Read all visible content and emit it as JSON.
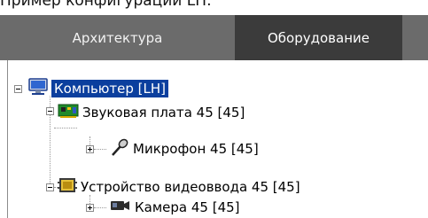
{
  "caption": "Пример конфигурации LH:",
  "tabs": [
    {
      "label": "Архитектура",
      "active": false
    },
    {
      "label": "Оборудование",
      "active": true
    }
  ],
  "tree": {
    "root": {
      "label": "Компьютер [LH]",
      "icon": "computer-icon",
      "expanded": true,
      "selected": true
    },
    "sound_card": {
      "label": "Звуковая плата 45 [45]",
      "icon": "sound-card-icon",
      "expanded": true
    },
    "microphone": {
      "label": "Микрофон 45 [45]",
      "icon": "microphone-icon",
      "expanded": false
    },
    "video_device": {
      "label": "Устройство видеоввода 45 [45]",
      "icon": "video-capture-icon",
      "expanded": true
    },
    "camera": {
      "label": "Камера 45 [45]",
      "icon": "camera-icon",
      "expanded": false
    }
  },
  "colors": {
    "tab_bar": "#6b6b6b",
    "tab_active": "#3b3b3b",
    "selection": "#0b3f9e"
  }
}
